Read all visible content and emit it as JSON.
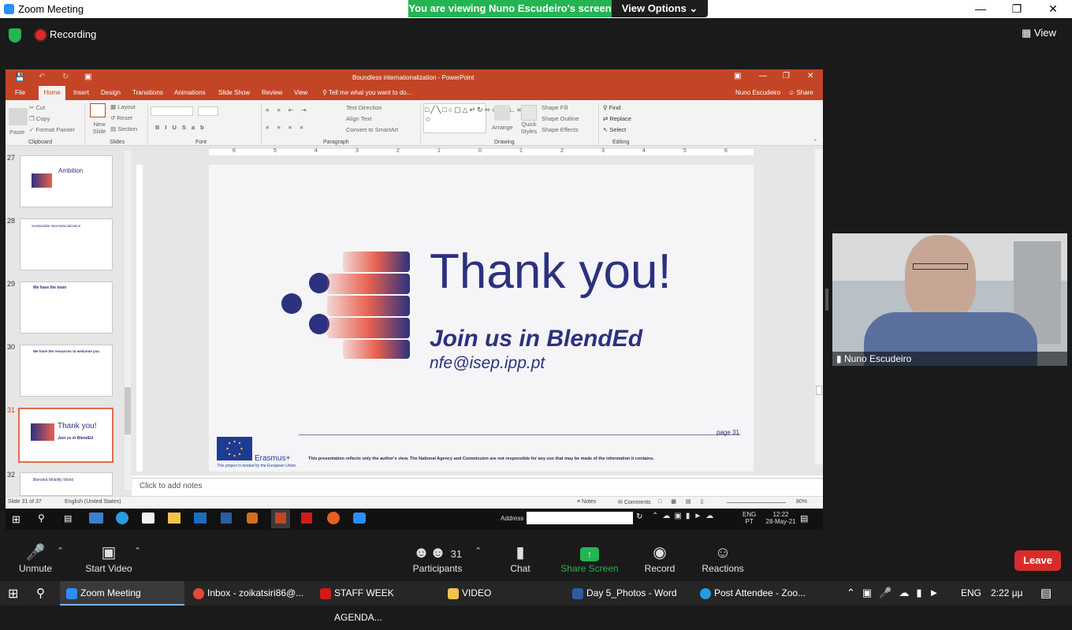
{
  "window": {
    "title": "Zoom Meeting"
  },
  "banner": {
    "viewing": "You are viewing Nuno Escudeiro's screen",
    "view_options": "View Options"
  },
  "top": {
    "recording": "Recording",
    "view": "View"
  },
  "ppt": {
    "filename": "Boundless internationalization - PowerPoint",
    "user": "Nuno Escudeiro",
    "share": "Share",
    "tabs": [
      "File",
      "Home",
      "Insert",
      "Design",
      "Transitions",
      "Animations",
      "Slide Show",
      "Review",
      "View"
    ],
    "tell_me": "Tell me what you want to do...",
    "groups": [
      "Clipboard",
      "Slides",
      "Font",
      "Paragraph",
      "Drawing",
      "Editing"
    ],
    "clipboard": {
      "paste": "Paste",
      "cut": "Cut",
      "copy": "Copy",
      "format_painter": "Format Painter"
    },
    "slides": {
      "new_slide": "New Slide",
      "layout": "Layout",
      "reset": "Reset",
      "section": "Section"
    },
    "paragraph": {
      "text_direction": "Text Direction",
      "align_text": "Align Text",
      "smartart": "Convert to SmartArt"
    },
    "drawing": {
      "arrange": "Arrange",
      "quick_styles": "Quick Styles",
      "fill": "Shape Fill",
      "outline": "Shape Outline",
      "effects": "Shape Effects"
    },
    "editing": {
      "find": "Find",
      "replace": "Replace",
      "select": "Select"
    },
    "thumbs": [
      {
        "num": "27",
        "title": "Ambition"
      },
      {
        "num": "28",
        "title": "Sustainable internationalization"
      },
      {
        "num": "29",
        "title": "We have the team"
      },
      {
        "num": "30",
        "title": "We have the resources to welcome you"
      },
      {
        "num": "31",
        "title": "Thank you!",
        "sub": "Join us in BlendEd"
      },
      {
        "num": "32",
        "title": "Blended Mobility World"
      }
    ],
    "slide": {
      "heading": "Thank you!",
      "tagline": "Join us in BlendEd",
      "email": "nfe@isep.ipp.pt",
      "page": "page 31",
      "erasmus": "Erasmus+",
      "funded": "This project is funded by the European Union.",
      "disclaimer": "This presentation reflects only the author's view. The National Agency and Commission are not responsible for any use that may be made of the information it contains."
    },
    "notes_placeholder": "Click to add notes",
    "status": {
      "slide": "Slide 31 of 37",
      "language": "English (United States)",
      "notes": "Notes",
      "comments": "Comments",
      "zoom": "80%"
    },
    "ruler_h": [
      "6",
      "5",
      "4",
      "3",
      "2",
      "1",
      "0",
      "1",
      "2",
      "3",
      "4",
      "5",
      "6"
    ]
  },
  "remote_taskbar": {
    "address_label": "Address",
    "lang": "ENG",
    "lang2": "PT",
    "time": "12:22",
    "date": "28-May-21"
  },
  "video": {
    "name": "Nuno Escudeiro"
  },
  "toolbar": {
    "unmute": "Unmute",
    "start_video": "Start Video",
    "participants": "Participants",
    "participants_count": "31",
    "chat": "Chat",
    "share": "Share Screen",
    "record": "Record",
    "reactions": "Reactions",
    "leave": "Leave"
  },
  "taskbar": {
    "apps": [
      "Zoom Meeting",
      "Inbox - zoikatsiri86@...",
      "STAFF WEEK AGENDA...",
      "VIDEO",
      "Day 5_Photos - Word",
      "Post Attendee - Zoo..."
    ],
    "lang": "ENG",
    "time": "2:22 μμ"
  },
  "colors": {
    "zoom_green": "#23b453",
    "ppt_orange": "#c44526",
    "slide_navy": "#2c3180",
    "leave_red": "#d92b2b"
  }
}
